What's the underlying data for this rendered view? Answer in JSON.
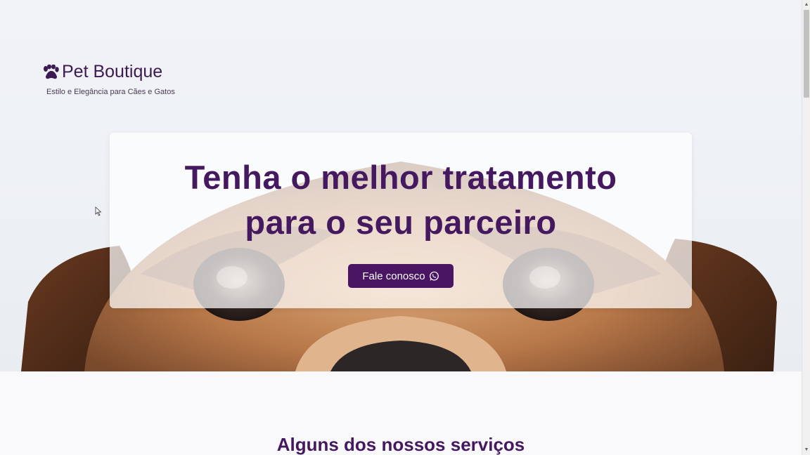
{
  "brand": {
    "icon": "paw-icon",
    "title": "Pet Boutique",
    "tagline": "Estilo e Elegância para Cães e Gatos"
  },
  "hero": {
    "headline_line1": "Tenha o melhor tratamento",
    "headline_line2": "para o seu parceiro",
    "cta_label": "Fale conosco",
    "cta_icon": "whatsapp-icon"
  },
  "services": {
    "title": "Alguns dos nossos serviços"
  },
  "colors": {
    "brand_purple": "#451960",
    "button_purple": "#4a1563"
  }
}
